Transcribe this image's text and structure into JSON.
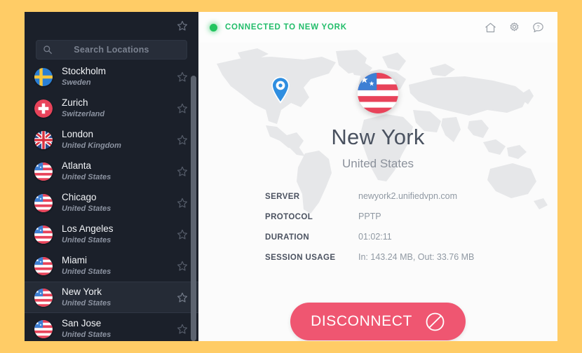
{
  "theme": {
    "page_background": "#FFCC66",
    "sidebar_background": "#1b202a",
    "accent_green": "#22bd6a",
    "disconnect_red": "#ef5671",
    "pin_blue": "#2f8ee0"
  },
  "sidebar": {
    "favorites_star_icon": "star-icon",
    "search": {
      "icon": "search-icon",
      "placeholder": "Search Locations",
      "value": ""
    },
    "locations": [
      {
        "city": "Stockholm",
        "country": "Sweden",
        "flag": "se",
        "favorite": false,
        "selected": false
      },
      {
        "city": "Zurich",
        "country": "Switzerland",
        "flag": "ch",
        "favorite": false,
        "selected": false
      },
      {
        "city": "London",
        "country": "United Kingdom",
        "flag": "gb",
        "favorite": false,
        "selected": false
      },
      {
        "city": "Atlanta",
        "country": "United States",
        "flag": "us",
        "favorite": false,
        "selected": false
      },
      {
        "city": "Chicago",
        "country": "United States",
        "flag": "us",
        "favorite": false,
        "selected": false
      },
      {
        "city": "Los Angeles",
        "country": "United States",
        "flag": "us",
        "favorite": false,
        "selected": false
      },
      {
        "city": "Miami",
        "country": "United States",
        "flag": "us",
        "favorite": false,
        "selected": false
      },
      {
        "city": "New York",
        "country": "United States",
        "flag": "us",
        "favorite": false,
        "selected": true
      },
      {
        "city": "San Jose",
        "country": "United States",
        "flag": "us",
        "favorite": false,
        "selected": false
      }
    ]
  },
  "statusbar": {
    "indicator": "connected-dot",
    "text": "CONNECTED TO NEW YORK",
    "icons": [
      {
        "name": "home-icon",
        "label": "Home"
      },
      {
        "name": "gear-icon",
        "label": "Settings"
      },
      {
        "name": "help-icon",
        "label": "Help"
      }
    ]
  },
  "main": {
    "map_pin_icon": "map-pin-icon",
    "flag_badge": "us",
    "city": "New York",
    "country": "United States",
    "details": [
      {
        "label": "SERVER",
        "value": "newyork2.unifiedvpn.com"
      },
      {
        "label": "PROTOCOL",
        "value": "PPTP"
      },
      {
        "label": "DURATION",
        "value": "01:02:11"
      },
      {
        "label": "SESSION USAGE",
        "value": "In: 143.24 MB, Out: 33.76 MB"
      }
    ],
    "disconnect": {
      "label": "DISCONNECT",
      "icon": "block-icon"
    }
  }
}
